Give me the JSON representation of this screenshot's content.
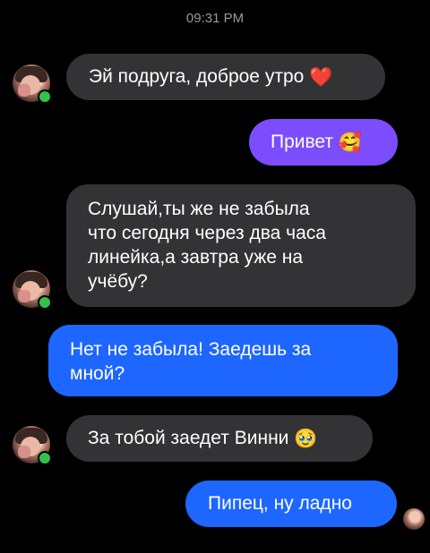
{
  "header": {
    "time": "09:31 PM"
  },
  "messages": [
    {
      "text": "Эй подруга, доброе утро",
      "emoji": "❤️",
      "sender": "friend"
    },
    {
      "text": "Привет",
      "emoji": "🥰",
      "sender": "me"
    },
    {
      "lines": [
        "Слушай,ты же не забыла",
        "что сегодня через два часа",
        "линейка,а завтра уже на",
        "учёбу?"
      ],
      "sender": "friend"
    },
    {
      "lines": [
        "Нет не забыла! Заедешь за",
        "мной?"
      ],
      "sender": "me"
    },
    {
      "text": "За тобой заедет Винни",
      "emoji": "🥹",
      "sender": "friend"
    },
    {
      "text": "Пипец, ну ладно",
      "sender": "me"
    }
  ],
  "colors": {
    "background": "#000000",
    "incoming_bubble": "#333335",
    "outgoing_purple": "#7b4dff",
    "outgoing_blue": "#1d66ff",
    "online_dot": "#31c24a"
  },
  "icons": [
    "friend-avatar",
    "online-status-indicator",
    "my-avatar"
  ]
}
